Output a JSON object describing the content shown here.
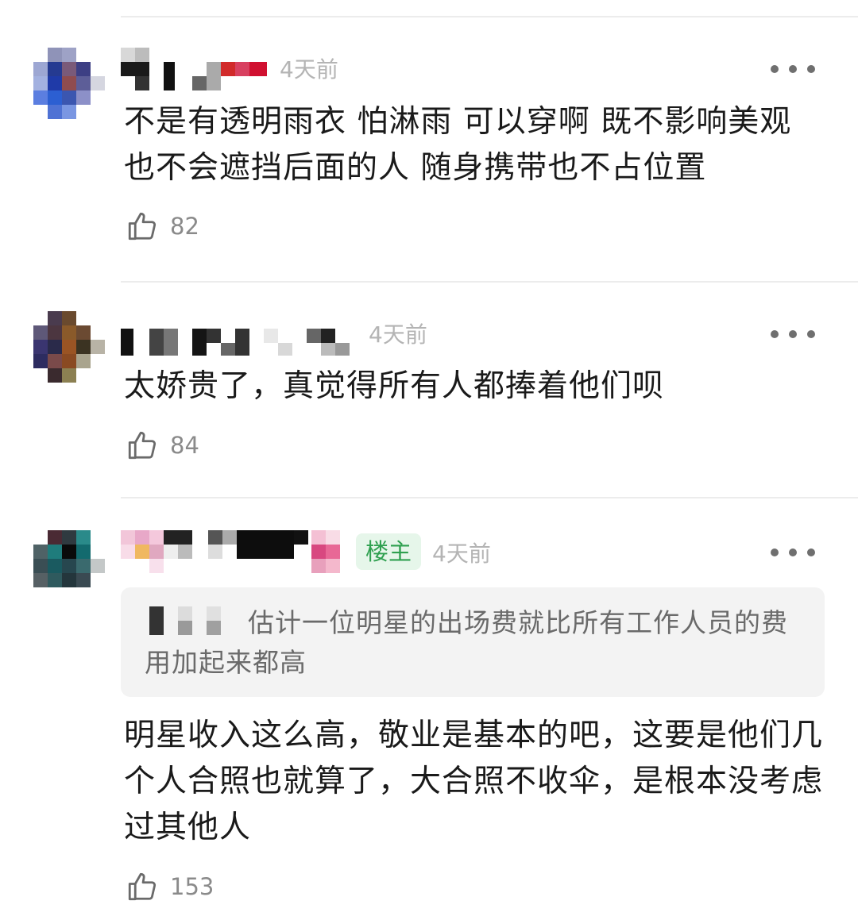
{
  "comments": [
    {
      "time": "4天前",
      "text": "不是有透明雨衣 怕淋雨 可以穿啊 既不影响美观 也不会遮挡后面的人  随身携带也不占位置",
      "likes": "82"
    },
    {
      "time": "4天前",
      "text": "太娇贵了，真觉得所有人都捧着他们呗",
      "likes": "84"
    },
    {
      "time": "4天前",
      "badge": "楼主",
      "quote": "估计一位明星的出场费就比所有工作人员的费用加起来都高",
      "text": "明星收入这么高，敬业是基本的吧，这要是他们几个人合照也就算了，大合照不收伞，是根本没考虑过其他人",
      "likes": "153"
    }
  ],
  "icons": {
    "like": "thumbs-up-icon",
    "more": "more-dots-icon"
  },
  "colors": {
    "badge_bg": "#e6f6ea",
    "badge_text": "#2ea04f",
    "meta_text": "#b4b4b4"
  }
}
